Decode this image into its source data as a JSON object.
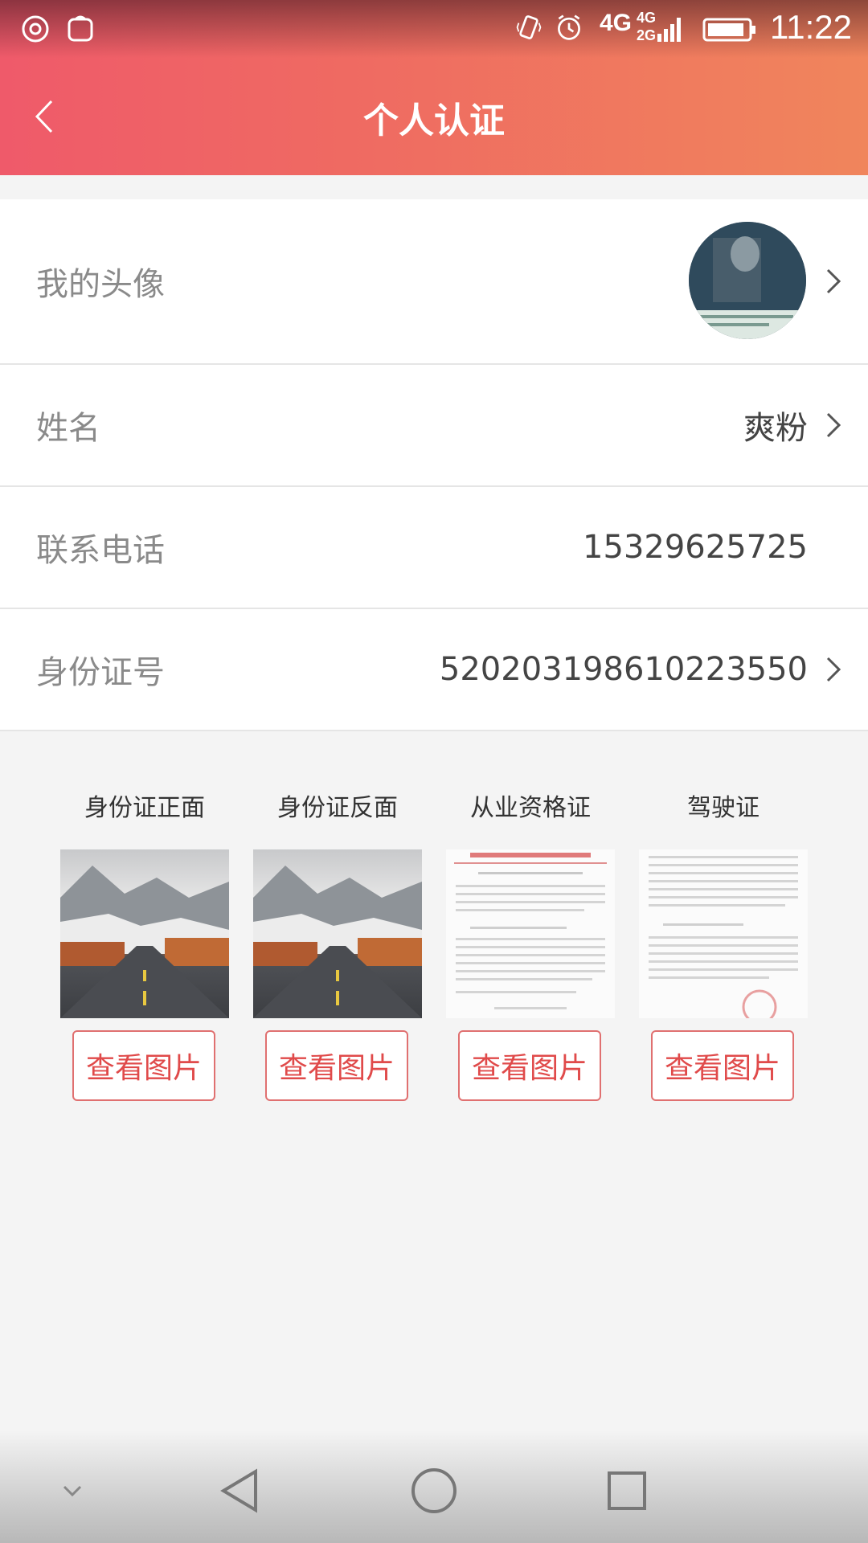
{
  "status_bar": {
    "time": "11:22",
    "net_primary": "4G",
    "net_secondary_top": "4G",
    "net_secondary_bottom": "2G"
  },
  "title_bar": {
    "title": "个人认证"
  },
  "profile": {
    "avatar_label": "我的头像",
    "name_label": "姓名",
    "name_value": "爽粉",
    "phone_label": "联系电话",
    "phone_value": "15329625725",
    "id_label": "身份证号",
    "id_value": "520203198610223550"
  },
  "documents": [
    {
      "label": "身份证正面",
      "button": "查看图片"
    },
    {
      "label": "身份证反面",
      "button": "查看图片"
    },
    {
      "label": "从业资格证",
      "button": "查看图片"
    },
    {
      "label": "驾驶证",
      "button": "查看图片"
    }
  ]
}
